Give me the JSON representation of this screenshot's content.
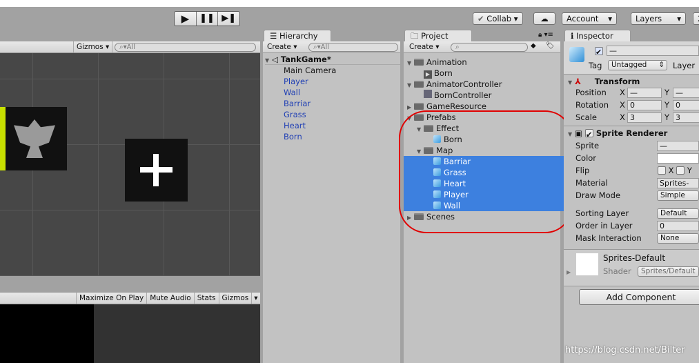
{
  "toolbar": {
    "play": "play-icon",
    "pause": "pause-icon",
    "step": "step-icon",
    "collab": "Collab",
    "account": "Account",
    "layers": "Layers",
    "layout": "2"
  },
  "scene": {
    "gizmos": "Gizmos",
    "search_placeholder": "All"
  },
  "game": {
    "maximize": "Maximize On Play",
    "mute": "Mute Audio",
    "stats": "Stats",
    "gizmos": "Gizmos"
  },
  "hierarchy": {
    "tab": "Hierarchy",
    "create": "Create",
    "search_placeholder": "All",
    "scene": "TankGame*",
    "items": [
      "Main Camera",
      "Player",
      "Wall",
      "Barriar",
      "Grass",
      "Heart",
      "Born"
    ]
  },
  "project": {
    "tab": "Project",
    "create": "Create",
    "tree": [
      {
        "label": "Animation",
        "type": "folder",
        "depth": 0,
        "open": true
      },
      {
        "label": "Born",
        "type": "anim",
        "depth": 1
      },
      {
        "label": "AnimatorController",
        "type": "folder",
        "depth": 0,
        "open": true
      },
      {
        "label": "BornController",
        "type": "controller",
        "depth": 1
      },
      {
        "label": "GameResource",
        "type": "folder",
        "depth": 0,
        "open": false
      },
      {
        "label": "Prefabs",
        "type": "folder",
        "depth": 0,
        "open": true
      },
      {
        "label": "Effect",
        "type": "folder",
        "depth": 1,
        "open": true
      },
      {
        "label": "Born",
        "type": "prefab",
        "depth": 2
      },
      {
        "label": "Map",
        "type": "folder",
        "depth": 1,
        "open": true
      },
      {
        "label": "Barriar",
        "type": "prefab",
        "depth": 2,
        "selected": true
      },
      {
        "label": "Grass",
        "type": "prefab",
        "depth": 2,
        "selected": true
      },
      {
        "label": "Heart",
        "type": "prefab",
        "depth": 2,
        "selected": true
      },
      {
        "label": "Player",
        "type": "prefab",
        "depth": 2,
        "selected": true
      },
      {
        "label": "Wall",
        "type": "prefab",
        "depth": 2,
        "selected": true
      },
      {
        "label": "Scenes",
        "type": "folder",
        "depth": 0,
        "open": false
      }
    ]
  },
  "inspector": {
    "tab": "Inspector",
    "name": "—",
    "tag_label": "Tag",
    "tag": "Untagged",
    "layer_label": "Layer",
    "transform": {
      "title": "Transform",
      "position": "Position",
      "rotation": "Rotation",
      "scale": "Scale",
      "x": "X",
      "y": "Y",
      "pos_x": "—",
      "pos_y": "—",
      "rot_x": "0",
      "rot_y": "0",
      "scale_x": "3",
      "scale_y": "3"
    },
    "sprite_renderer": {
      "title": "Sprite Renderer",
      "sprite": "Sprite",
      "sprite_val": "—",
      "color": "Color",
      "flip": "Flip",
      "flip_x": "X",
      "flip_y": "Y",
      "material": "Material",
      "material_val": "Sprites-",
      "draw_mode": "Draw Mode",
      "draw_mode_val": "Simple",
      "sorting_layer": "Sorting Layer",
      "sorting_layer_val": "Default",
      "order": "Order in Layer",
      "order_val": "0",
      "mask": "Mask Interaction",
      "mask_val": "None"
    },
    "material": {
      "name": "Sprites-Default",
      "shader_label": "Shader",
      "shader": "Sprites/Default"
    },
    "add_component": "Add Component"
  },
  "watermark": "https://blog.csdn.net/Bilter",
  "colors": {
    "selection": "#3d80df",
    "highlight_ring": "#e00000",
    "scene_bg": "#474747"
  }
}
